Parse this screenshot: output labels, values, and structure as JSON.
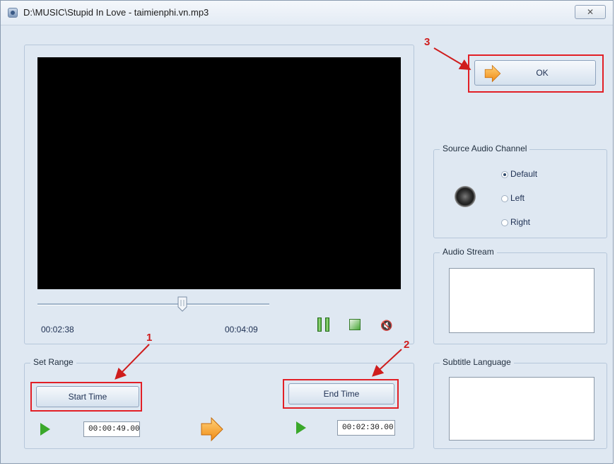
{
  "window": {
    "title": "D:\\MUSIC\\Stupid In Love - taimienphi.vn.mp3"
  },
  "player": {
    "current_time": "00:02:38",
    "total_time": "00:04:09"
  },
  "set_range": {
    "legend": "Set Range",
    "start_button": "Start Time",
    "end_button": "End Time",
    "start_value": "00:00:49.00",
    "end_value": "00:02:30.00"
  },
  "ok_button": "OK",
  "source_audio_channel": {
    "legend": "Source Audio Channel",
    "options": [
      "Default",
      "Left",
      "Right"
    ],
    "selected": "Default"
  },
  "audio_stream": {
    "legend": "Audio Stream"
  },
  "subtitle_language": {
    "legend": "Subtitle Language"
  },
  "annotations": [
    "1",
    "2",
    "3"
  ],
  "colors": {
    "highlight": "#e21f26",
    "play_green": "#3aa82b",
    "arrow_orange": "#f39a1e"
  }
}
